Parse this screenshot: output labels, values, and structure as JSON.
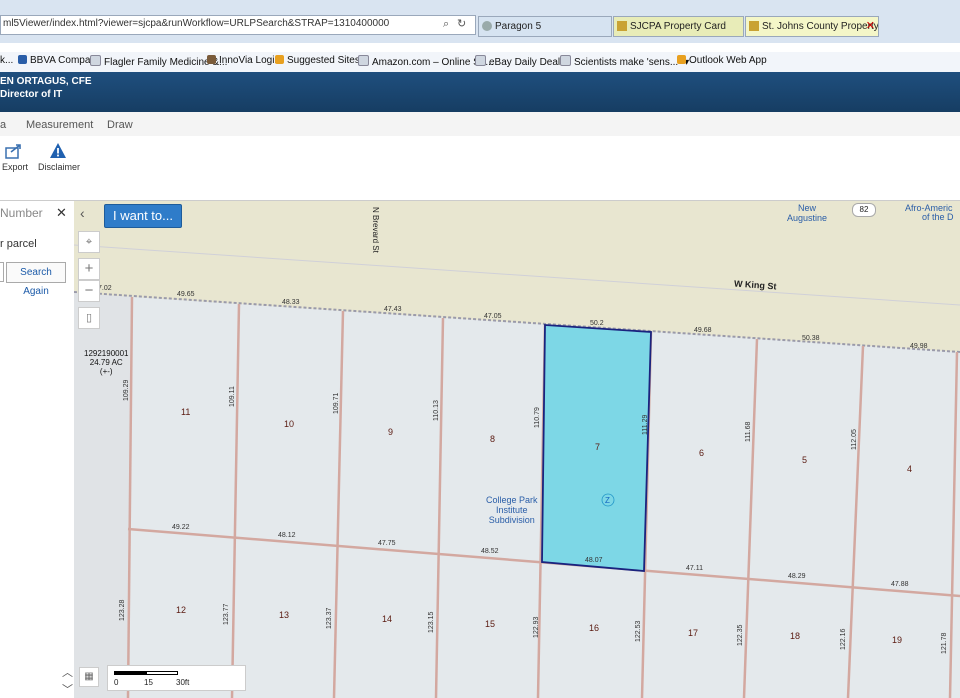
{
  "browser": {
    "address": "ml5Viewer/index.html?viewer=sjcpa&runWorkflow=URLPSearch&STRAP=1310400000",
    "tabs": [
      {
        "label": "Paragon 5"
      },
      {
        "label": "SJCPA Property Card"
      },
      {
        "label": "St. Johns County Property A..."
      }
    ],
    "favorites": [
      {
        "label": "k..."
      },
      {
        "label": "BBVA Compass"
      },
      {
        "label": "Flagler Family Medicine &..."
      },
      {
        "label": "InnoVia Login"
      },
      {
        "label": "Suggested Sites ▾"
      },
      {
        "label": "Amazon.com – Online Sh..."
      },
      {
        "label": "eBay Daily Deal ▾"
      },
      {
        "label": "Scientists make 'sens..."
      },
      {
        "label": "Outlook Web App"
      }
    ]
  },
  "header": {
    "name": "EN ORTAGUS, CFE",
    "role": "Director of IT"
  },
  "menu": {
    "items": [
      {
        "label": "a"
      },
      {
        "label": "Measurement"
      },
      {
        "label": "Draw"
      }
    ]
  },
  "toolbar": {
    "export_label": "Export",
    "disclaimer_label": "Disclaimer"
  },
  "left_panel": {
    "search_placeholder": "Number",
    "parcel_text": "r parcel",
    "search_again_label": "Search Again"
  },
  "map": {
    "i_want_to_label": "I want to...",
    "streets": {
      "brevard": "N Brevard St",
      "king": "W King St"
    },
    "places": {
      "new_augustine_1": "New",
      "new_augustine_2": "Augustine",
      "afro_1": "Afro-Americ",
      "afro_2": "of the D",
      "route": "82"
    },
    "parcel_info": {
      "id": "1292190001",
      "area": "24.79 AC",
      "note": "(+-)"
    },
    "subdivision": {
      "line1": "College Park",
      "line2": "Institute",
      "line3": "Subdivision"
    },
    "zone": "Z",
    "lots": [
      "11",
      "10",
      "9",
      "8",
      "7",
      "6",
      "5",
      "4",
      "12",
      "13",
      "14",
      "15",
      "16",
      "17",
      "18",
      "19"
    ],
    "dimensions": {
      "top": [
        "7.02",
        "49.65",
        "48.33",
        "47.43",
        "47.05",
        "50.2",
        "49.68",
        "50.38",
        "49.98"
      ],
      "middle": [
        "49.22",
        "48.12",
        "47.75",
        "48.52",
        "48.07",
        "47.11",
        "48.29",
        "47.88"
      ],
      "vertical_upper": [
        "109.29",
        "109.11",
        "109.71",
        "110.13",
        "110.79",
        "111.29",
        "111.68",
        "112.05"
      ],
      "vertical_lower": [
        "123.28",
        "123.77",
        "123.37",
        "123.15",
        "122.93",
        "122.53",
        "122.35",
        "122.16",
        "121.78"
      ]
    },
    "scale": {
      "zero": "0",
      "mid": "15",
      "end": "30ft"
    },
    "colors": {
      "road": "#e8e6d0",
      "parcel": "#e4e9ec",
      "selected": "#7dd7e6",
      "boundary": "#d3a8a0"
    }
  }
}
